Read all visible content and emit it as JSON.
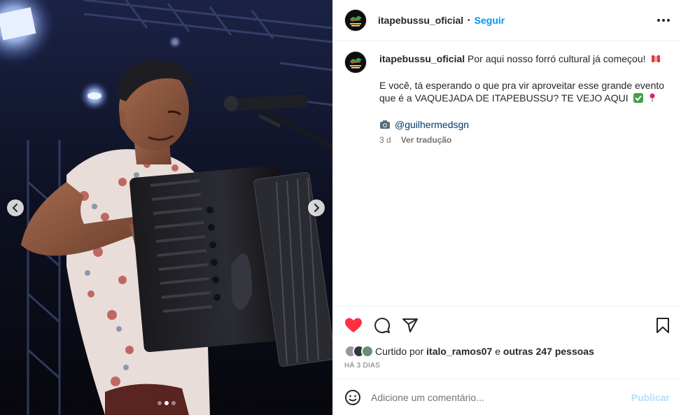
{
  "post": {
    "username": "itapebussu_oficial",
    "follow_label": "Seguir",
    "caption_line1": "Por aqui nosso forró cultural já começou!",
    "caption_line2": "E você, tá esperando o que pra vir aproveitar esse grande evento que é a VAQUEJADA DE ITAPEBUSSU? TE VEJO AQUI",
    "credit_handle": "@guilhermedsgn",
    "time_ago": "3 d",
    "translate_label": "Ver tradução",
    "liked_by_prefix": "Curtido por",
    "liked_by_user": "italo_ramos07",
    "liked_by_connector": "e",
    "liked_by_others": "outras 247 pessoas",
    "date_label": "HÁ 3 DIAS"
  },
  "comment_box": {
    "placeholder": "Adicione um comentário...",
    "publish_label": "Publicar"
  },
  "carousel": {
    "slide_count": 3,
    "active_index": 1
  },
  "icons": {
    "like": "heart-filled-icon",
    "comment": "comment-icon",
    "share": "send-icon",
    "save": "bookmark-icon",
    "emoji": "smiley-icon",
    "more": "more-horizontal-icon",
    "credit": "camera-icon",
    "caption_emojis": [
      "accordion-emoji",
      "check-mark-emoji",
      "pin-emoji"
    ]
  },
  "colors": {
    "like_red": "#ff3040",
    "link_blue": "#0095f6",
    "publish_disabled": "#b2dffc"
  }
}
